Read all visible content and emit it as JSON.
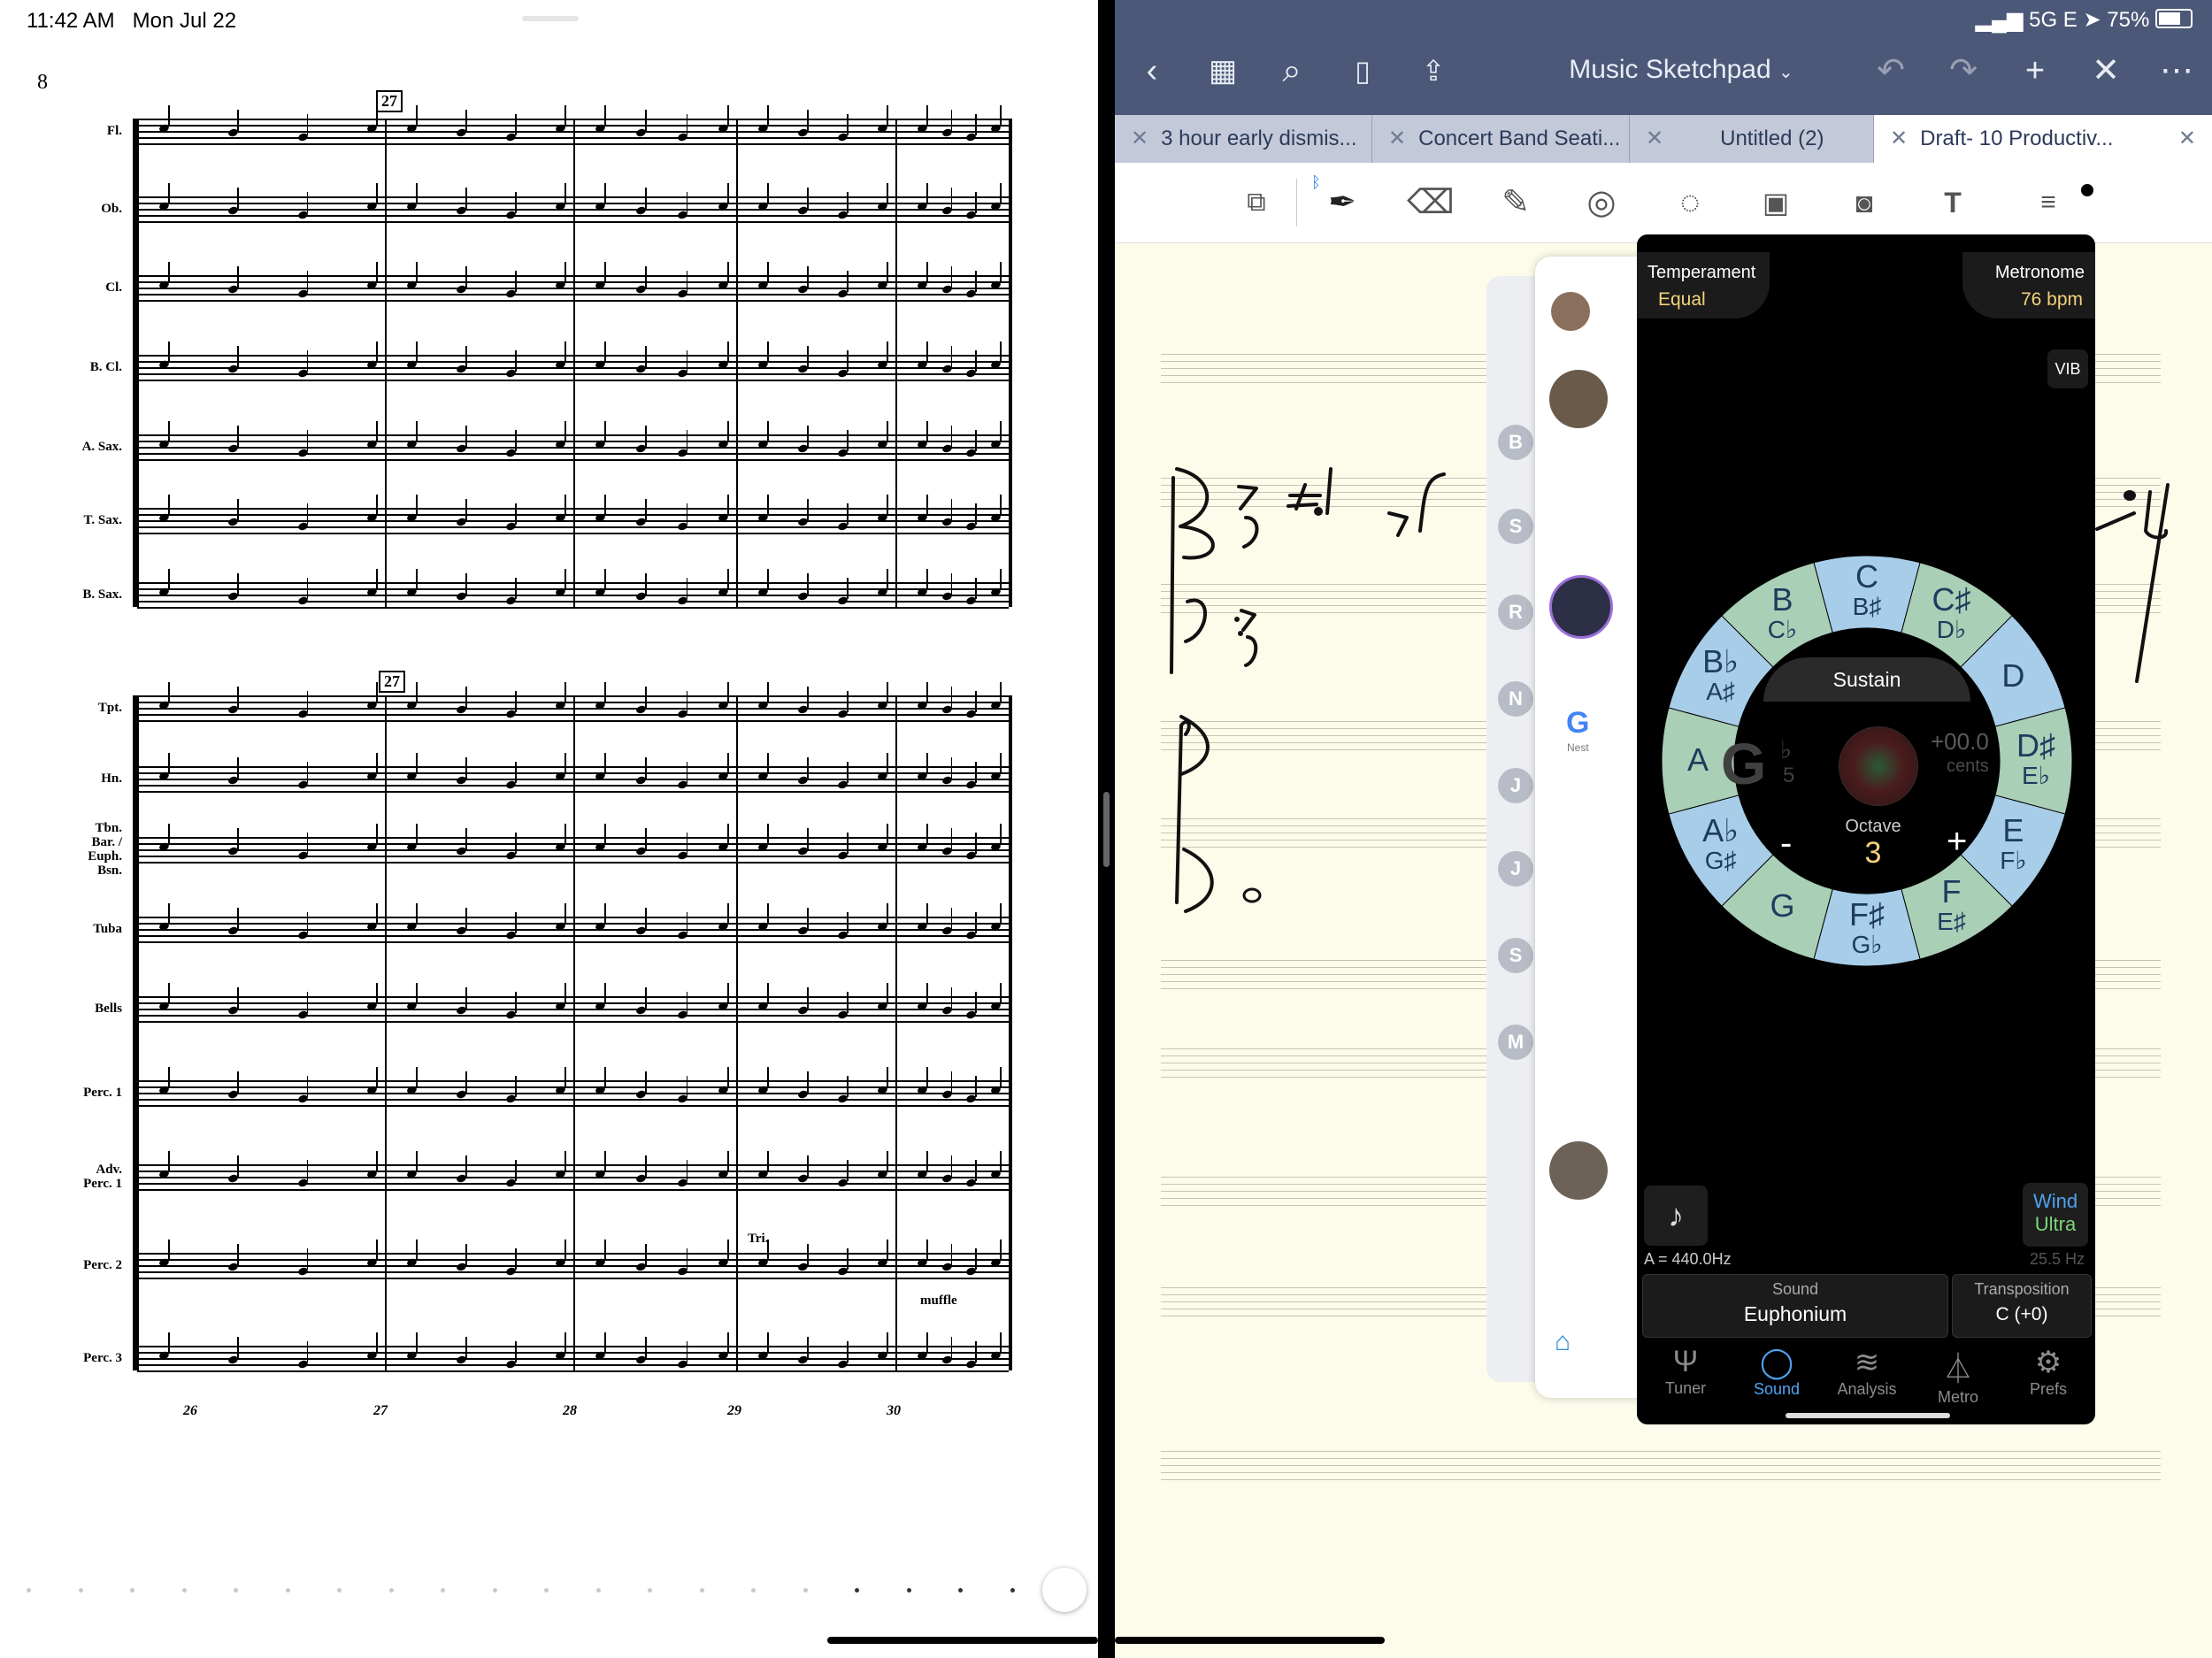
{
  "left_pane": {
    "status": {
      "time": "11:42 AM",
      "date": "Mon Jul 22"
    },
    "page_number": "8",
    "rehearsal_mark": "27",
    "instruments_top": [
      "Fl.",
      "Ob.",
      "Cl.",
      "B. Cl.",
      "A. Sax.",
      "T. Sax.",
      "B. Sax."
    ],
    "instruments_bottom": [
      "Tpt.",
      "Hn.",
      "Tbn. Bar. / Euph. Bsn.",
      "Tuba",
      "Bells",
      "Perc. 1",
      "Adv. Perc. 1",
      "Perc. 2",
      "Perc. 3"
    ],
    "measure_numbers": [
      "26",
      "27",
      "28",
      "29",
      "30"
    ],
    "annotations": {
      "tri": "Tri.",
      "muffle": "muffle"
    }
  },
  "right_pane": {
    "status": {
      "signal": "5G E",
      "battery": "75%"
    },
    "app_title": "Music Sketchpad",
    "tabs": [
      "3 hour early dismis...",
      "Concert Band Seati...",
      "Untitled (2)",
      "Draft- 10 Productiv..."
    ],
    "tuner": {
      "temperament_label": "Temperament",
      "temperament_value": "Equal",
      "metronome_label": "Metronome",
      "metronome_value": "76 bpm",
      "vib": "VIB",
      "sustain": "Sustain",
      "current_note": "G",
      "current_flat": "♭",
      "current_octave_sub": "5",
      "cents_value": "+00.0",
      "cents_label": "cents",
      "octave_label": "Octave",
      "octave_value": "3",
      "octave_minus": "-",
      "octave_plus": "+",
      "notes": [
        {
          "main": "C",
          "alt": "B♯"
        },
        {
          "main": "C♯",
          "alt": "D♭"
        },
        {
          "main": "D",
          "alt": ""
        },
        {
          "main": "D♯",
          "alt": "E♭"
        },
        {
          "main": "E",
          "alt": "F♭"
        },
        {
          "main": "F",
          "alt": "E♯"
        },
        {
          "main": "F♯",
          "alt": "G♭"
        },
        {
          "main": "G",
          "alt": ""
        },
        {
          "main": "A♭",
          "alt": "G♯"
        },
        {
          "main": "A",
          "alt": ""
        },
        {
          "main": "B♭",
          "alt": "A♯"
        },
        {
          "main": "B",
          "alt": "C♭"
        }
      ],
      "reference": "A = 440.0Hz",
      "hz_readout": "25.5 Hz",
      "wind_label": "Wind",
      "ultra_label": "Ultra",
      "sound_label": "Sound",
      "sound_value": "Euphonium",
      "transposition_label": "Transposition",
      "transposition_value": "C (+0)",
      "bottom_tabs": [
        "Tuner",
        "Sound",
        "Analysis",
        "Metro",
        "Prefs"
      ],
      "active_tab": "Sound",
      "colors": {
        "green": "#a9cfb6",
        "blue": "#a8cde8",
        "gold": "#f3d27a",
        "accent": "#4ea3f3"
      }
    },
    "notifications": {
      "avatars": [
        "B",
        "S",
        "R",
        "N",
        "J",
        "J",
        "S",
        "M"
      ],
      "google_nest": "Nest"
    }
  }
}
